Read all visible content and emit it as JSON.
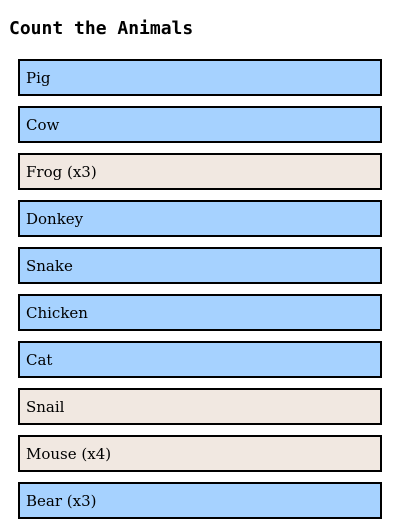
{
  "title": "Count the Animals",
  "colors": {
    "blue": "#a6d2ff",
    "beige": "#f1e8e1",
    "border": "#000000"
  },
  "items": [
    {
      "label": "Pig",
      "color": "blue"
    },
    {
      "label": "Cow",
      "color": "blue"
    },
    {
      "label": "Frog (x3)",
      "color": "beige"
    },
    {
      "label": "Donkey",
      "color": "blue"
    },
    {
      "label": "Snake",
      "color": "blue"
    },
    {
      "label": "Chicken",
      "color": "blue"
    },
    {
      "label": "Cat",
      "color": "blue"
    },
    {
      "label": "Snail",
      "color": "beige"
    },
    {
      "label": "Mouse (x4)",
      "color": "beige"
    },
    {
      "label": "Bear (x3)",
      "color": "blue"
    }
  ]
}
